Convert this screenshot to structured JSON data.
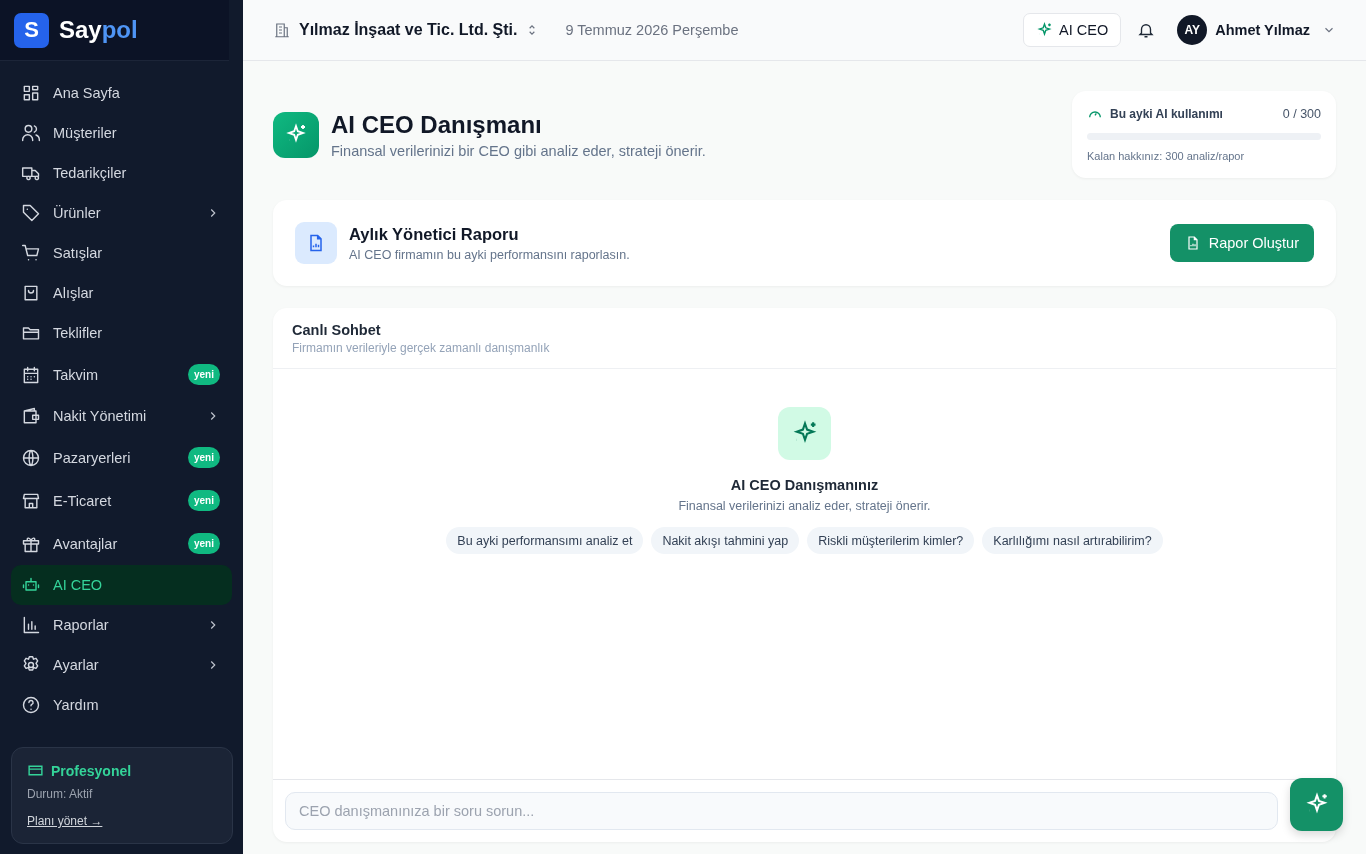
{
  "brand": {
    "first": "Say",
    "second": "pol",
    "mark": "S"
  },
  "sidebar": {
    "items": [
      {
        "label": "Ana Sayfa",
        "selected": false,
        "submenu": false
      },
      {
        "label": "Müşteriler",
        "selected": false,
        "submenu": false
      },
      {
        "label": "Tedarikçiler",
        "selected": false,
        "submenu": false
      },
      {
        "label": "Ürünler",
        "selected": false,
        "submenu": true
      },
      {
        "label": "Satışlar",
        "selected": false,
        "submenu": false
      },
      {
        "label": "Alışlar",
        "selected": false,
        "submenu": false
      },
      {
        "label": "Teklifler",
        "selected": false,
        "submenu": false
      },
      {
        "label": "Takvim",
        "selected": false,
        "submenu": false,
        "badge": "yeni"
      },
      {
        "label": "Nakit Yönetimi",
        "selected": false,
        "submenu": true
      },
      {
        "label": "Pazaryerleri",
        "selected": false,
        "submenu": false,
        "badge": "yeni"
      },
      {
        "label": "E-Ticaret",
        "selected": false,
        "submenu": false,
        "badge": "yeni"
      },
      {
        "label": "Avantajlar",
        "selected": false,
        "submenu": false,
        "badge": "yeni"
      },
      {
        "label": "AI CEO",
        "selected": true,
        "submenu": false
      },
      {
        "label": "Raporlar",
        "selected": false,
        "submenu": true
      },
      {
        "label": "Ayarlar",
        "selected": false,
        "submenu": true
      },
      {
        "label": "Yardım",
        "selected": false,
        "submenu": false
      }
    ],
    "plan": {
      "name": "Profesyonel",
      "status": "Durum: Aktif",
      "link": "Planı yönet →"
    }
  },
  "header": {
    "company": "Yılmaz İnşaat ve Tic. Ltd. Şti.",
    "date": "9 Temmuz 2026 Perşembe",
    "ai_button": "AI CEO",
    "user": {
      "initials": "AY",
      "name": "Ahmet Yılmaz"
    }
  },
  "page": {
    "title": "AI CEO Danışmanı",
    "subtitle": "Finansal verilerinizi bir CEO gibi analiz eder, strateji önerir."
  },
  "usage": {
    "title": "Bu ayki AI kullanımı",
    "count": "0 / 300",
    "level": 0,
    "remaining": "Kalan hakkınız: 300 analiz/rapor"
  },
  "report": {
    "title": "Aylık Yönetici Raporu",
    "subtitle": "AI CEO firmamın bu ayki performansını raporlasın.",
    "button": "Rapor Oluştur"
  },
  "chat": {
    "title": "Canlı Sohbet",
    "subtitle": "Firmamın verileriyle gerçek zamanlı danışmanlık",
    "empty_title": "AI CEO Danışmanınız",
    "empty_subtitle": "Finansal verilerinizi analiz eder, strateji önerir.",
    "suggestions": [
      "Bu ayki performansımı analiz et",
      "Nakit akışı tahmini yap",
      "Riskli müşterilerim kimler?",
      "Karlılığımı nasıl artırabilirim?"
    ],
    "input": {
      "placeholder": "CEO danışmanınıza bir soru sorun..."
    }
  }
}
